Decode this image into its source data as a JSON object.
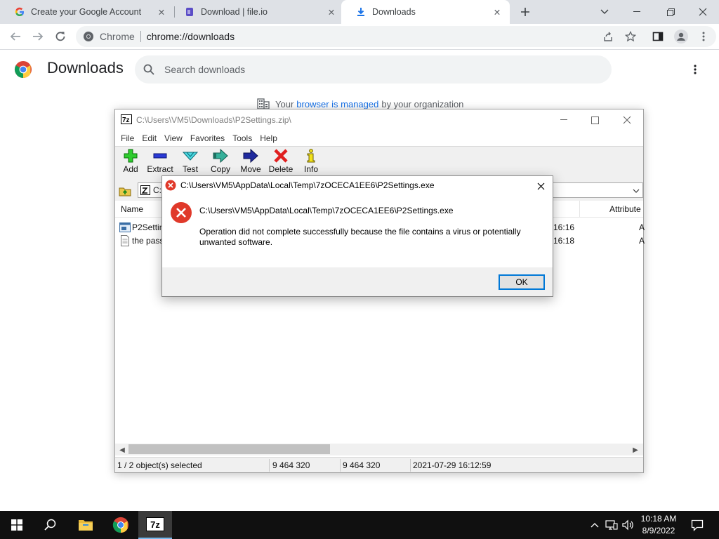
{
  "browser": {
    "tabs": [
      {
        "title": "Create your Google Account",
        "icon": "google-g-icon"
      },
      {
        "title": "Download | file.io",
        "icon": "file-io-icon"
      },
      {
        "title": "Downloads",
        "icon": "download-arrow-icon",
        "active": true
      }
    ],
    "omnibox": {
      "site_chip": "Chrome",
      "url": "chrome://downloads"
    }
  },
  "downloads_page": {
    "title": "Downloads",
    "search_placeholder": "Search downloads",
    "managed": {
      "prefix": "Your",
      "link": "browser is managed",
      "suffix": "by your organization"
    }
  },
  "sevenzip": {
    "title": "C:\\Users\\VM5\\Downloads\\P2Settings.zip\\",
    "menu": [
      "File",
      "Edit",
      "View",
      "Favorites",
      "Tools",
      "Help"
    ],
    "tools": [
      {
        "label": "Add",
        "icon": "add-plus-icon"
      },
      {
        "label": "Extract",
        "icon": "extract-minus-icon"
      },
      {
        "label": "Test",
        "icon": "test-check-icon"
      },
      {
        "label": "Copy",
        "icon": "copy-arrow-icon"
      },
      {
        "label": "Move",
        "icon": "move-arrow-icon"
      },
      {
        "label": "Delete",
        "icon": "delete-x-icon"
      },
      {
        "label": "Info",
        "icon": "info-i-icon"
      }
    ],
    "address_prefix": "C:",
    "columns": {
      "name": "Name",
      "attributes": "Attribute"
    },
    "rows": [
      {
        "name": "P2Settin",
        "time": "9 16:16",
        "attr": "A"
      },
      {
        "name": "the pass",
        "time": "9 16:18",
        "attr": "A"
      }
    ],
    "status": {
      "selected": "1 / 2 object(s) selected",
      "size": "9 464 320",
      "packed": "9 464 320",
      "modified": "2021-07-29 16:12:59"
    }
  },
  "dialog": {
    "title": "C:\\Users\\VM5\\AppData\\Local\\Temp\\7zOCECA1EE6\\P2Settings.exe",
    "path": "C:\\Users\\VM5\\AppData\\Local\\Temp\\7zOCECA1EE6\\P2Settings.exe",
    "message": "Operation did not complete successfully because the file contains a virus or potentially unwanted software.",
    "ok_label": "OK"
  },
  "taskbar": {
    "time": "10:18 AM",
    "date": "8/9/2022",
    "zip_label": "7z"
  }
}
